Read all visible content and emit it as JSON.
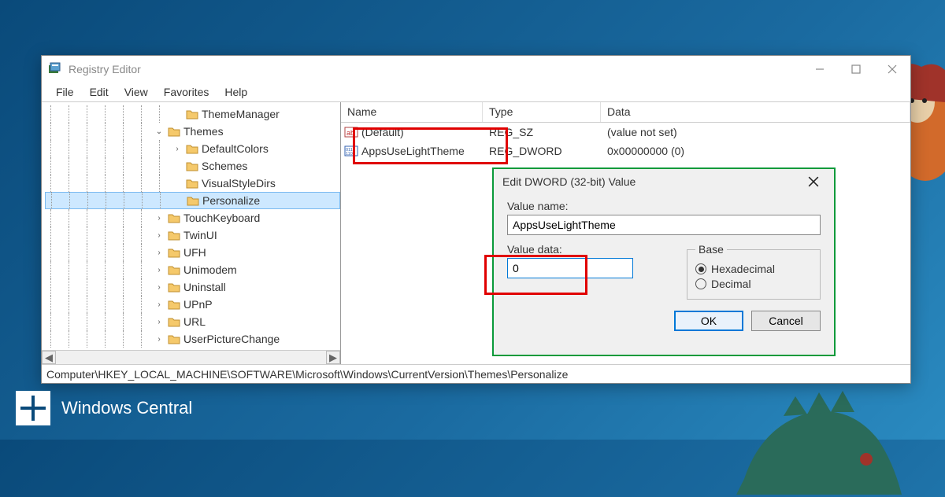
{
  "window": {
    "title": "Registry Editor",
    "menu": [
      "File",
      "Edit",
      "View",
      "Favorites",
      "Help"
    ],
    "statusbar": "Computer\\HKEY_LOCAL_MACHINE\\SOFTWARE\\Microsoft\\Windows\\CurrentVersion\\Themes\\Personalize"
  },
  "tree": {
    "items": [
      {
        "depth": 7,
        "toggle": "",
        "label": "ThemeManager"
      },
      {
        "depth": 6,
        "toggle": "v",
        "label": "Themes"
      },
      {
        "depth": 7,
        "toggle": ">",
        "label": "DefaultColors"
      },
      {
        "depth": 7,
        "toggle": "",
        "label": "Schemes"
      },
      {
        "depth": 7,
        "toggle": "",
        "label": "VisualStyleDirs"
      },
      {
        "depth": 7,
        "toggle": "",
        "label": "Personalize",
        "selected": true
      },
      {
        "depth": 6,
        "toggle": ">",
        "label": "TouchKeyboard"
      },
      {
        "depth": 6,
        "toggle": ">",
        "label": "TwinUI"
      },
      {
        "depth": 6,
        "toggle": ">",
        "label": "UFH"
      },
      {
        "depth": 6,
        "toggle": ">",
        "label": "Unimodem"
      },
      {
        "depth": 6,
        "toggle": ">",
        "label": "Uninstall"
      },
      {
        "depth": 6,
        "toggle": ">",
        "label": "UPnP"
      },
      {
        "depth": 6,
        "toggle": ">",
        "label": "URL"
      },
      {
        "depth": 6,
        "toggle": ">",
        "label": "UserPictureChange"
      }
    ]
  },
  "list": {
    "headers": {
      "name": "Name",
      "type": "Type",
      "data": "Data"
    },
    "rows": [
      {
        "iconType": "sz",
        "name": "(Default)",
        "type": "REG_SZ",
        "data": "(value not set)"
      },
      {
        "iconType": "dw",
        "name": "AppsUseLightTheme",
        "type": "REG_DWORD",
        "data": "0x00000000 (0)"
      }
    ]
  },
  "dialog": {
    "title": "Edit DWORD (32-bit) Value",
    "valueNameLabel": "Value name:",
    "valueName": "AppsUseLightTheme",
    "valueDataLabel": "Value data:",
    "valueData": "0",
    "baseLabel": "Base",
    "radioHex": "Hexadecimal",
    "radioDec": "Decimal",
    "okLabel": "OK",
    "cancelLabel": "Cancel"
  },
  "watermark": "Windows Central"
}
